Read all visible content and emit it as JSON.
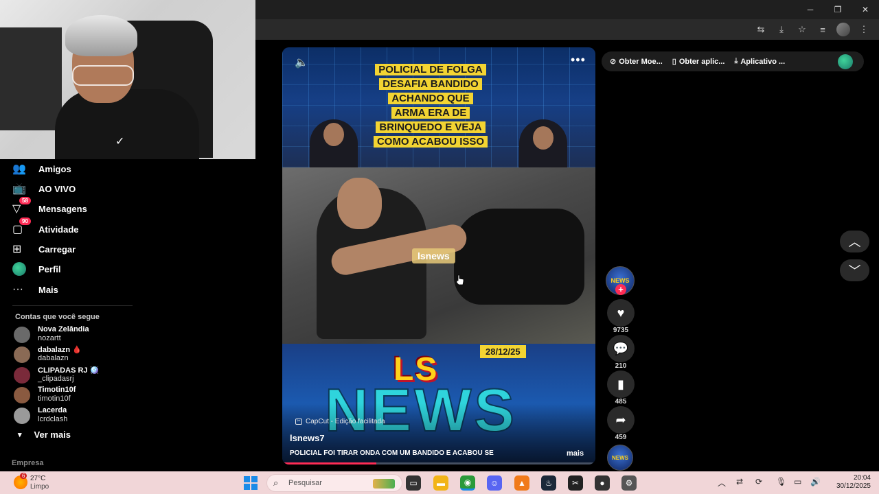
{
  "browser": {
    "window_controls": {
      "minimize": "─",
      "maximize": "❐",
      "close": "✕"
    }
  },
  "top_bar": {
    "items": [
      {
        "label": "Obter Moe...",
        "icon": "coin-icon"
      },
      {
        "label": "Obter aplic...",
        "icon": "phone-icon"
      },
      {
        "label": "Aplicativo ...",
        "icon": "download-icon"
      }
    ]
  },
  "sidebar": {
    "nav": [
      {
        "label": "Amigos",
        "icon": "friends-icon",
        "badge": ""
      },
      {
        "label": "AO VIVO",
        "icon": "live-icon",
        "badge": ""
      },
      {
        "label": "Mensagens",
        "icon": "messages-icon",
        "badge": "58"
      },
      {
        "label": "Atividade",
        "icon": "activity-icon",
        "badge": "90"
      },
      {
        "label": "Carregar",
        "icon": "upload-icon",
        "badge": ""
      },
      {
        "label": "Perfil",
        "icon": "profile-icon",
        "badge": ""
      },
      {
        "label": "Mais",
        "icon": "more-icon",
        "badge": ""
      }
    ],
    "following_title": "Contas que você segue",
    "following": [
      {
        "name": "Nova Zelândia",
        "user": "nozartt"
      },
      {
        "name": "dabalazn 🩸",
        "user": "dabalazn"
      },
      {
        "name": "CLIPADAS RJ 🪩",
        "user": "_clipadasrj"
      },
      {
        "name": "Timotin10f",
        "user": "timotin10f"
      },
      {
        "name": "Lacerda",
        "user": "lcrdclash"
      }
    ],
    "see_more": "Ver mais",
    "company": "Empresa"
  },
  "video": {
    "headline_lines": [
      "POLICIAL DE FOLGA",
      "DESAFIA BANDIDO",
      "ACHANDO QUE",
      "ARMA ERA DE",
      "BRINQUEDO E VEJA",
      "COMO ACABOU ISSO"
    ],
    "watermark": "lsnews",
    "date": "28/12/25",
    "logo_top": "LS",
    "logo_bottom": "NEWS",
    "capcut": "CapCut - Edição facilitada",
    "author": "lsnews7",
    "caption": "POLICIAL FOI TIRAR ONDA COM UM BANDIDO E ACABOU SE",
    "more": "mais",
    "progress": 0.3,
    "menu": "•••"
  },
  "actions": {
    "avatar_label": "NEWS",
    "likes": "9735",
    "comments": "210",
    "saves": "485",
    "shares": "459"
  },
  "taskbar": {
    "temperature": "27°C",
    "weather": "Limpo",
    "weather_badge": "6",
    "search_placeholder": "Pesquisar",
    "time": "20:04",
    "date": "30/12/2025"
  }
}
